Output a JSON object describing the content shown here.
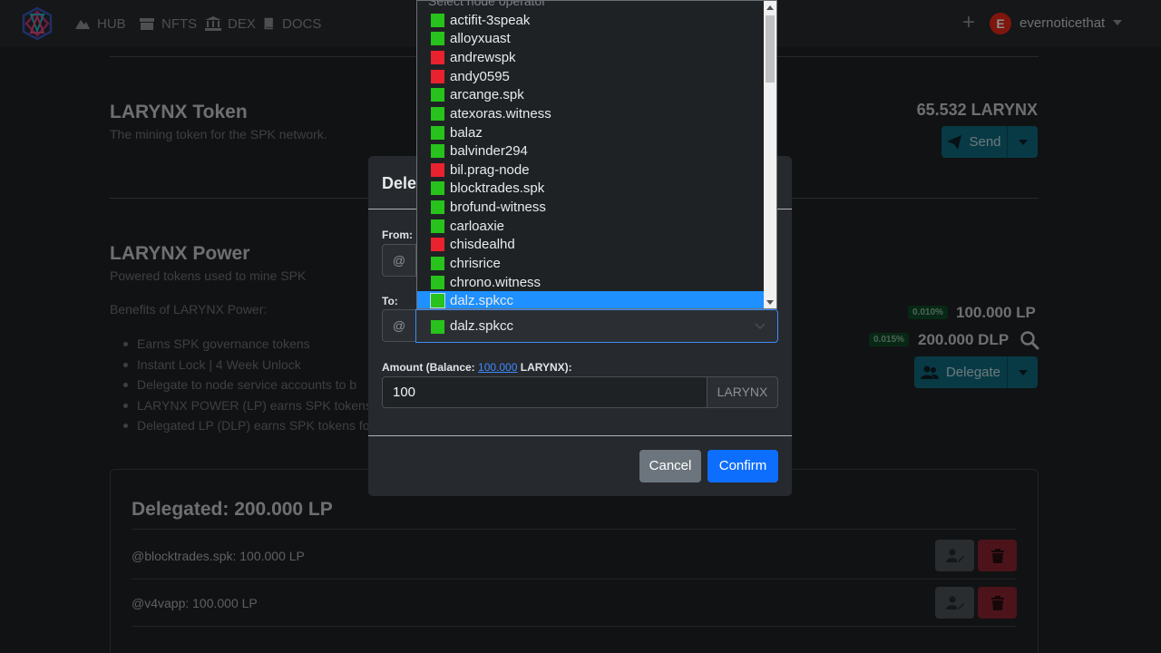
{
  "nav": {
    "links": [
      {
        "label": "HUB",
        "icon": "rocket-icon"
      },
      {
        "label": "NFTS",
        "icon": "store-icon"
      },
      {
        "label": "DEX",
        "icon": "bank-icon"
      },
      {
        "label": "DOCS",
        "icon": "book-icon"
      }
    ],
    "plus_label": "+",
    "avatar_letter": "E",
    "username": "evernoticethat"
  },
  "token": {
    "title": "LARYNX Token",
    "subtitle": "The mining token for the SPK network.",
    "balance": "65.532 LARYNX",
    "send_label": "Send"
  },
  "power": {
    "title": "LARYNX Power",
    "subtitle": "Powered tokens used to mine SPK",
    "benefits_title": "Benefits of LARYNX Power:",
    "benefits": [
      "Earns SPK governance tokens",
      "Instant Lock | 4 Week Unlock",
      "Delegate to node service accounts to b",
      "LARYNX POWER (LP) earns SPK tokens",
      "Delegated LP (DLP) earns SPK tokens fo"
    ],
    "lp_badge": "0.010%",
    "lp_amount": "100.000 LP",
    "dlp_badge": "0.015%",
    "dlp_amount": "200.000 DLP",
    "delegate_label": "Delegate"
  },
  "delegated": {
    "title": "Delegated: 200.000 LP",
    "rows": [
      {
        "text": "@blocktrades.spk: 100.000 LP"
      },
      {
        "text": "@v4vapp: 100.000 LP"
      }
    ]
  },
  "modal": {
    "title": "Dele",
    "from_label": "From:",
    "to_label": "To:",
    "at_symbol": "@",
    "selected_operator": "dalz.spkcc",
    "amount_label_prefix": "Amount (Balance:",
    "amount_balance_link": "100.000",
    "amount_label_suffix": "LARYNX):",
    "amount_value": "100",
    "amount_unit": "LARYNX",
    "cancel_label": "Cancel",
    "confirm_label": "Confirm"
  },
  "dropdown": {
    "placeholder": "Select node operator",
    "options": [
      {
        "name": "actifit-3speak",
        "status": "green"
      },
      {
        "name": "alloyxuast",
        "status": "green"
      },
      {
        "name": "andrewspk",
        "status": "red"
      },
      {
        "name": "andy0595",
        "status": "red"
      },
      {
        "name": "arcange.spk",
        "status": "green"
      },
      {
        "name": "atexoras.witness",
        "status": "green"
      },
      {
        "name": "balaz",
        "status": "green"
      },
      {
        "name": "balvinder294",
        "status": "green"
      },
      {
        "name": "bil.prag-node",
        "status": "red"
      },
      {
        "name": "blocktrades.spk",
        "status": "green"
      },
      {
        "name": "brofund-witness",
        "status": "green"
      },
      {
        "name": "carloaxie",
        "status": "green"
      },
      {
        "name": "chisdealhd",
        "status": "red"
      },
      {
        "name": "chrisrice",
        "status": "green"
      },
      {
        "name": "chrono.witness",
        "status": "green"
      },
      {
        "name": "dalz.spkcc",
        "status": "green",
        "selected": true
      }
    ]
  },
  "colors": {
    "status_green": "#28c21c",
    "status_red": "#e8232f",
    "accent_teal": "#0f6b80",
    "accent_blue": "#0d6efd",
    "highlight_blue": "#1e90ff"
  }
}
